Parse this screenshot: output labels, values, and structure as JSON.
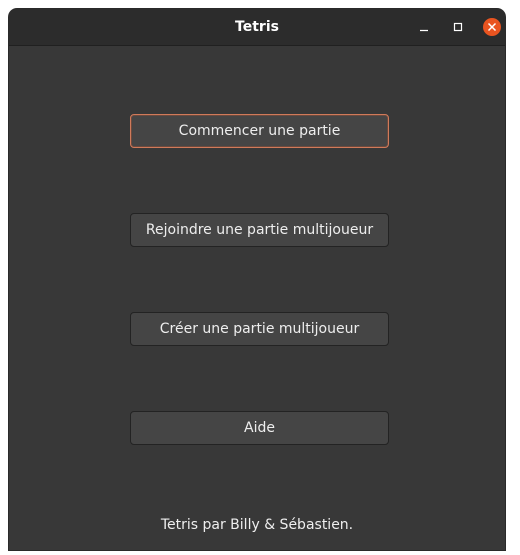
{
  "window": {
    "title": "Tetris",
    "controls": {
      "minimize_icon": "minimize-icon",
      "maximize_icon": "maximize-icon",
      "close_icon": "close-icon",
      "close_color": "#e95420"
    }
  },
  "menu": {
    "start_label": "Commencer une partie",
    "join_label": "Rejoindre une partie multijoueur",
    "create_label": "Créer une partie multijoueur",
    "help_label": "Aide"
  },
  "footer": {
    "credits": "Tetris par Billy & Sébastien."
  },
  "colors": {
    "window_bg": "#383838",
    "titlebar_bg": "#2c2c2c",
    "button_bg": "#454545",
    "focus_border": "#d07a5a",
    "text": "#eeeeee"
  }
}
